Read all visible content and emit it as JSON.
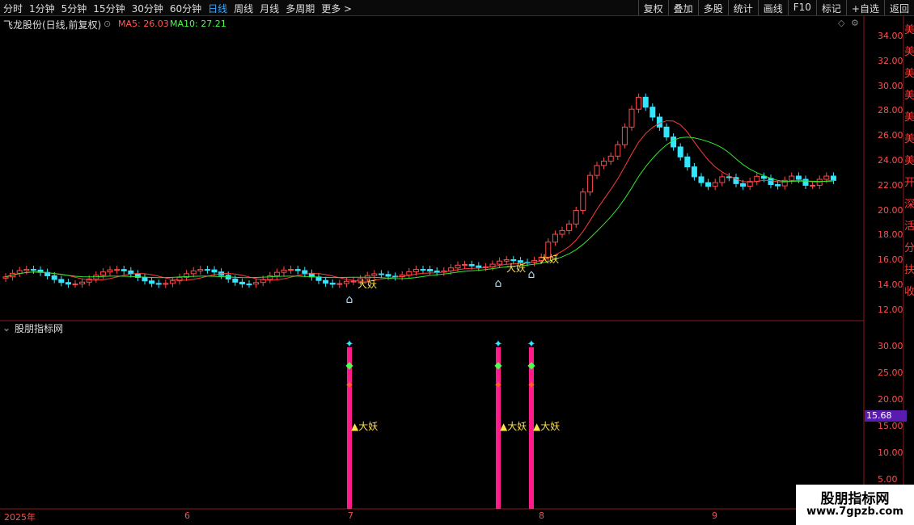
{
  "toolbar": {
    "left": [
      "分时",
      "1分钟",
      "5分钟",
      "15分钟",
      "30分钟",
      "60分钟",
      "日线",
      "周线",
      "月线",
      "多周期",
      "更多 >"
    ],
    "active": "日线",
    "right": [
      "复权",
      "叠加",
      "多股",
      "统计",
      "画线",
      "F10",
      "标记",
      "+自选",
      "返回"
    ]
  },
  "info": {
    "stock": "飞龙股份(日线,前复权)",
    "ma5": "MA5: 26.03",
    "ma10": "MA10: 27.21"
  },
  "price_axis": [
    "34.00",
    "32.00",
    "30.00",
    "28.00",
    "26.00",
    "24.00",
    "22.00",
    "20.00",
    "18.00",
    "16.00",
    "14.00",
    "12.00"
  ],
  "indicator": {
    "title": "股朋指标网",
    "axis": [
      "30.00",
      "25.00",
      "20.00",
      "15.00",
      "10.00",
      "5.00"
    ],
    "current": "15.68",
    "signal_label": "大妖"
  },
  "dates": [
    "2025年",
    "6",
    "7",
    "8",
    "9"
  ],
  "watermark": {
    "name": "股朋指标网",
    "url": "www.7gpzb.com"
  },
  "colors": {
    "up": "#ff4a4a",
    "down": "#33e6ff",
    "ma5": "#ff3a3a",
    "ma10": "#33e633",
    "bar": "#ff1a8c"
  },
  "right_edge_chars": [
    "美",
    "美",
    "美",
    "美",
    "美",
    "美",
    "美",
    "开",
    "深",
    "活",
    "分",
    "扶",
    "收"
  ]
}
